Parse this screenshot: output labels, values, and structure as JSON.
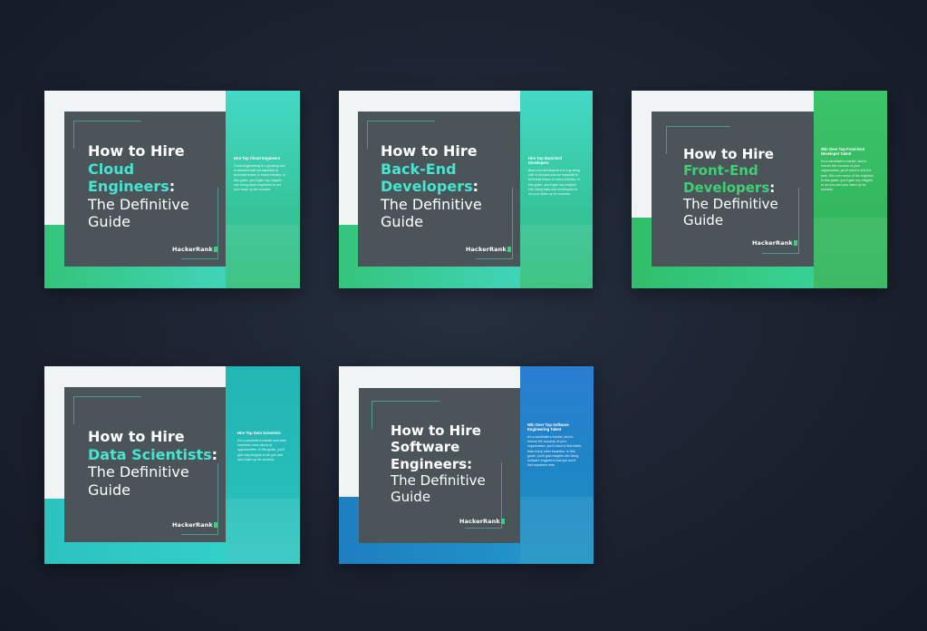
{
  "brand": "HackerRank",
  "colors": {
    "teal_highlight": "#45e6d0",
    "green_highlight": "#3fcf75",
    "cover_gray": "#4a5459",
    "page_background": "#1b2230"
  },
  "guides": [
    {
      "line1": "How to Hire",
      "highlight_lines": [
        "Cloud",
        "Engineers"
      ],
      "colon": ":",
      "subtitle_lines": [
        "The Definitive",
        "Guide"
      ],
      "panel_heading": "Hire Top Cloud Engineers",
      "panel_body": "Cloud engineering is a growing and in-demand skill set essential to technical teams in every industry. In this guide, you'll gain key insights into hiring cloud engineers to set your team up for success.",
      "logo": "HackerRank"
    },
    {
      "line1": "How to Hire",
      "highlight_lines": [
        "Back-End",
        "Developers"
      ],
      "colon": ":",
      "subtitle_lines": [
        "The Definitive",
        "Guide"
      ],
      "panel_heading": "Hire Top Back-End Developers",
      "panel_body": "Back-end development is a growing skill in demand and an essential to technical teams in every industry. In this guide, you'll gain key insights into hiring back-end developers to set your team up for success.",
      "logo": "HackerRank"
    },
    {
      "line1": "How to Hire",
      "highlight_lines": [
        "Front-End",
        "Developers"
      ],
      "colon": ":",
      "subtitle_lines": [
        "The Definitive",
        "Guide"
      ],
      "panel_heading": "Win Over Top Front-End Developer Talent",
      "panel_body": "It's a candidate's market, and to ensure the success of your organization, you'll need to find the best. Win over some of the brightest. In this guide, you'll gain key insights to set you and your team up for success.",
      "logo": "HackerRank"
    },
    {
      "line1": "How to Hire",
      "highlight_lines": [
        "Data Scientists"
      ],
      "colon": ":",
      "subtitle_lines": [
        "The Definitive",
        "Guide"
      ],
      "panel_heading": "Hire Top Data Scientists",
      "panel_body": "It's a candidate's market and data scientists have plenty of opportunities. In this guide, you'll gain key insights to set you and your team up for success.",
      "logo": "HackerRank"
    },
    {
      "line1": "How to Hire",
      "highlight_lines": [
        "Software",
        "Engineers"
      ],
      "colon": ":",
      "subtitle_lines": [
        "The Definitive",
        "Guide"
      ],
      "panel_heading": "Win Over Top Software Engineering Talent",
      "panel_body": "It's a candidate's market, and to ensure the success of your organization, you'll need to find better than every other business. In this guide, you'll gain insights into hiring software engineers that you won't find anywhere else.",
      "logo": "HackerRank"
    }
  ]
}
